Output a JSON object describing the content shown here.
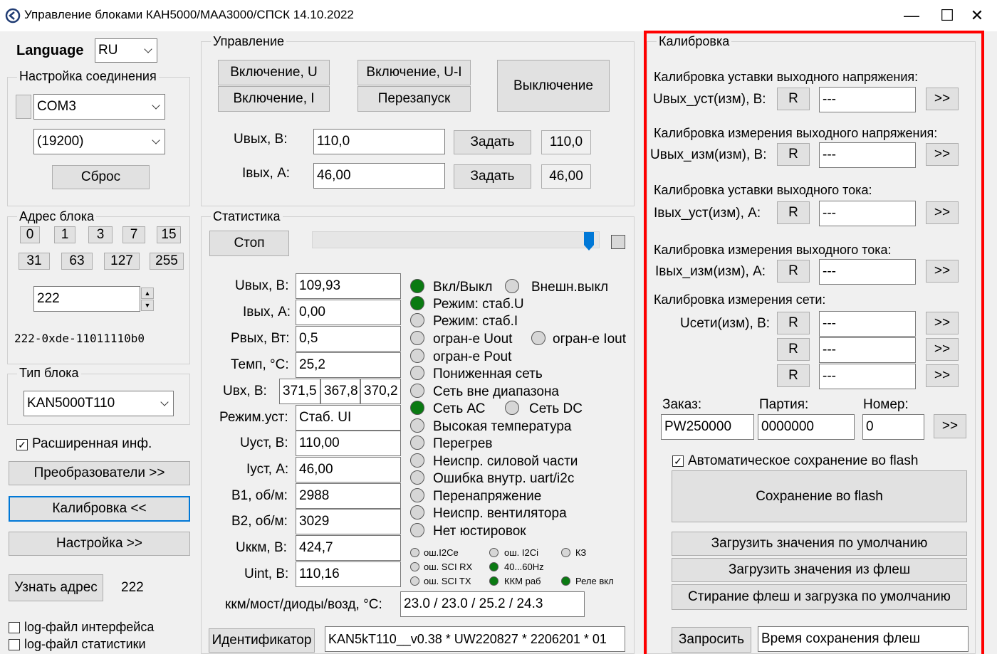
{
  "window": {
    "title": "Управление блоками КАН5000/МАА3000/СПСК 14.10.2022",
    "min": "—",
    "max": "☐",
    "close": "✕"
  },
  "language": {
    "label": "Language",
    "value": "RU"
  },
  "connection": {
    "legend": "Настройка соединения",
    "port": "COM3",
    "baud": "(19200)",
    "reset": "Сброс"
  },
  "address": {
    "legend": "Адрес блока",
    "buttons": [
      "0",
      "1",
      "3",
      "7",
      "15",
      "31",
      "63",
      "127",
      "255"
    ],
    "value": "222",
    "info": "222-0xde-11011110b0"
  },
  "block_type": {
    "legend": "Тип блока",
    "value": "KAN5000T110"
  },
  "extended": {
    "label": "Расширенная инф.",
    "checked": true
  },
  "nav": {
    "converters": "Преобразователи >>",
    "calibration": "Калибровка <<",
    "settings": "Настройка >>",
    "get_address": "Узнать адрес",
    "address_value": "222"
  },
  "logs": {
    "interface": "log-файл интерфейса",
    "stats": "log-файл статистики"
  },
  "control": {
    "legend": "Управление",
    "on_u": "Включение, U",
    "on_ui": "Включение, U-I",
    "on_i": "Включение, I",
    "restart": "Перезапуск",
    "off": "Выключение",
    "uout_label": "Uвых, В:",
    "uout_value": "110,0",
    "set1": "Задать",
    "uout_read": "110,0",
    "iout_label": "Iвых, А:",
    "iout_value": "46,00",
    "set2": "Задать",
    "iout_read": "46,00"
  },
  "stats": {
    "legend": "Статистика",
    "stop": "Стоп",
    "slider_level": 1.0,
    "rows": [
      {
        "label": "Uвых, В:",
        "value": "109,93"
      },
      {
        "label": "Iвых, А:",
        "value": "0,00"
      },
      {
        "label": "Рвых, Вт:",
        "value": "0,5"
      },
      {
        "label": "Темп, °С:",
        "value": "25,2"
      },
      {
        "label": "Режим.уст:",
        "value": "Стаб. UI"
      },
      {
        "label": "Uуст, В:",
        "value": "110,00"
      },
      {
        "label": "Iуст, А:",
        "value": "46,00"
      },
      {
        "label": "В1, об/м:",
        "value": "2988"
      },
      {
        "label": "В2, об/м:",
        "value": "3029"
      },
      {
        "label": "Uккм, В:",
        "value": "424,7"
      },
      {
        "label": "Uint, В:",
        "value": "110,16"
      }
    ],
    "uin": {
      "label": "Uвх, В:",
      "v1": "371,5",
      "v2": "367,8",
      "v3": "370,2"
    },
    "temps_label": "ккм/мост/диоды/возд, °С:",
    "temps_value": "23.0 / 23.0 / 25.2 / 24.3",
    "identifier": "Идентификатор",
    "id_value": "KAN5kT110__v0.38 * UW220827 * 2206201 * 01"
  },
  "indicators": {
    "on_off": "Вкл/Выкл",
    "ext_off": "Внешн.выкл",
    "stab_u": "Режим: стаб.U",
    "stab_i": "Режим: стаб.I",
    "lim_uout": "огран-е Uout",
    "lim_iout": "огран-е Iout",
    "lim_pout": "огран-е Pout",
    "low_net": "Пониженная сеть",
    "net_out": "Сеть вне диапазона",
    "net_ac": "Сеть АС",
    "net_dc": "Сеть DC",
    "high_temp": "Высокая температура",
    "overheat": "Перегрев",
    "power_fault": "Неиспр. силовой части",
    "uart_err": "Ошибка внутр. uart/i2c",
    "overvolt": "Перенапряжение",
    "fan_fault": "Неиспр. вентилятора",
    "no_adj": "Нет юстировок",
    "err_i2ce": "ош.I2Ce",
    "err_i2ci": "ош. I2Ci",
    "kz": "КЗ",
    "err_rx": "ош. SCI RX",
    "hz": "40...60Hz",
    "err_tx": "ош. SCI TX",
    "kkm": "ККМ раб",
    "relay": "Реле вкл",
    "colors": {
      "on": "#0a7a12",
      "off": "#d6d6d6"
    }
  },
  "calibration": {
    "legend": "Калибровка",
    "h1": "Калибровка уставки выходного напряжения:",
    "l1": "Uвых_уст(изм), В:",
    "h2": "Калибровка измерения выходного напряжения:",
    "l2": "Uвых_изм(изм), В:",
    "h3": "Калибровка уставки выходного тока:",
    "l3": "Iвых_уст(изм), А:",
    "h4": "Калибровка измерения выходного тока:",
    "l4": "Iвых_изм(изм), А:",
    "h5": "Калибровка измерения сети:",
    "l5": "Uсети(изм), В:",
    "r": "R",
    "placeholder": "---",
    "arrow": ">>",
    "order_label": "Заказ:",
    "order_value": "PW250000",
    "batch_label": "Партия:",
    "batch_value": "0000000",
    "number_label": "Номер:",
    "number_value": "0",
    "autosave": "Автоматическое сохранение во flash",
    "save": "Сохранение во flash",
    "load_default": "Загрузить значения по умолчанию",
    "load_flash": "Загрузить значения из флеш",
    "erase": "Стирание флеш и загрузка по умолчанию",
    "request": "Запросить",
    "save_time": "Время сохранения флеш",
    "highlight_color": "#ff0000"
  }
}
